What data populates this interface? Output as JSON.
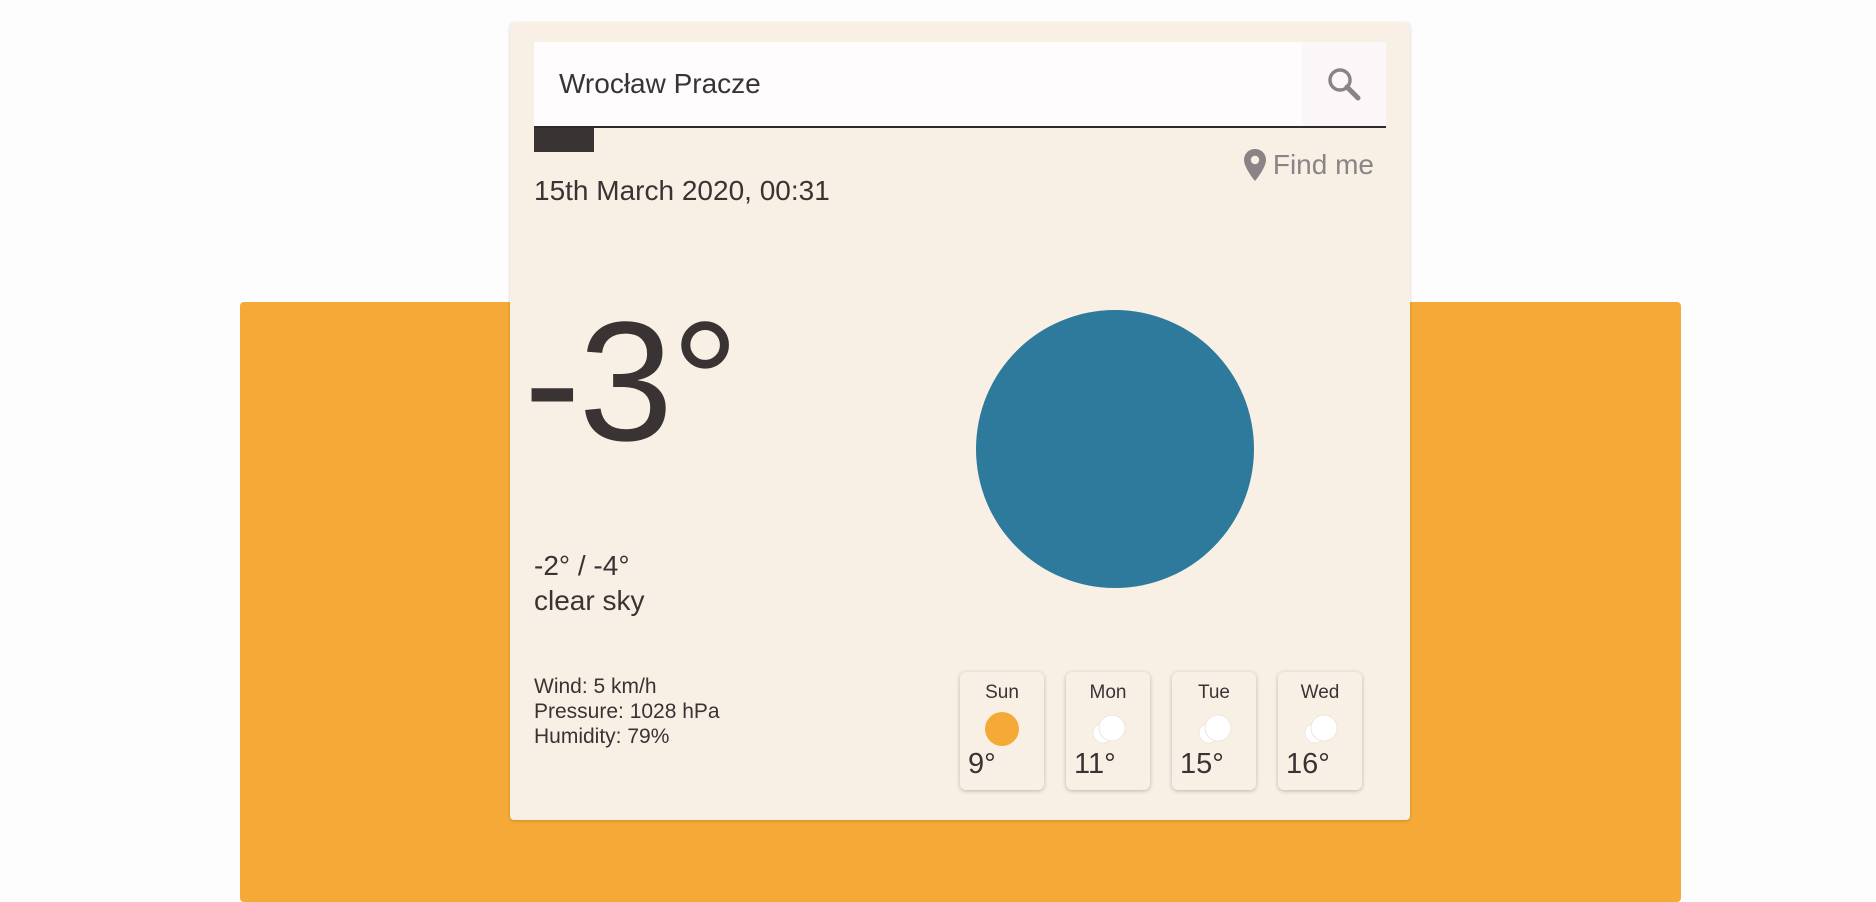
{
  "search": {
    "value": "Wrocław Pracze",
    "icon": "search-icon"
  },
  "location": {
    "find_me_label": "Find me",
    "icon": "map-pin-icon"
  },
  "current": {
    "date": "15th March 2020, 00:31",
    "temperature": "-3°",
    "range": "-2° / -4°",
    "description": "clear sky",
    "wind": "Wind: 5 km/h",
    "pressure": "Pressure: 1028 hPa",
    "humidity": "Humidity: 79%"
  },
  "forecast": [
    {
      "day": "Sun",
      "temp": "9°",
      "icon": "sun-icon"
    },
    {
      "day": "Mon",
      "temp": "11°",
      "icon": "cloud-icon"
    },
    {
      "day": "Tue",
      "temp": "15°",
      "icon": "cloud-icon"
    },
    {
      "day": "Wed",
      "temp": "16°",
      "icon": "cloud-icon"
    }
  ],
  "colors": {
    "backdrop": "#f5a937",
    "card": "#f9f0e5",
    "weather_circle": "#2e7a9c",
    "text": "#3a3334",
    "muted": "#8a8486"
  }
}
